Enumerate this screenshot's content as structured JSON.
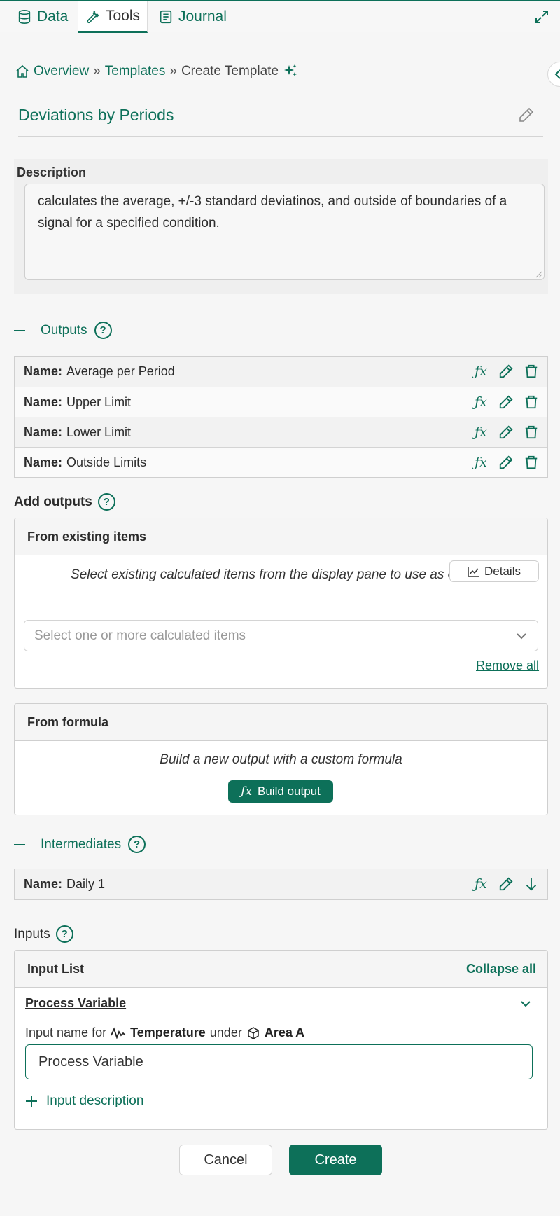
{
  "tabs": [
    {
      "label": "Data",
      "icon": "database-icon"
    },
    {
      "label": "Tools",
      "icon": "wrench-icon"
    },
    {
      "label": "Journal",
      "icon": "journal-icon"
    }
  ],
  "breadcrumb": {
    "items": [
      "Overview",
      "Templates",
      "Create Template"
    ],
    "separator": "»"
  },
  "template": {
    "title": "Deviations by Periods",
    "description_label": "Description",
    "description": "calculates the average, +/-3 standard deviatinos, and outside of boundaries of a signal for a specified condition."
  },
  "outputs": {
    "heading": "Outputs",
    "name_label": "Name:",
    "items": [
      "Average per Period",
      "Upper Limit",
      "Lower Limit",
      "Outside Limits"
    ]
  },
  "add_outputs": {
    "heading": "Add outputs",
    "existing": {
      "title": "From existing items",
      "text": "Select existing calculated items from the display pane to use as outputs",
      "details_label": "Details",
      "select_placeholder": "Select one or more calculated items",
      "remove_all": "Remove all"
    },
    "formula": {
      "title": "From formula",
      "text": "Build a new output with a custom formula",
      "button": "Build output"
    }
  },
  "intermediates": {
    "heading": "Intermediates",
    "name_label": "Name:",
    "items": [
      "Daily 1"
    ]
  },
  "inputs": {
    "heading": "Inputs",
    "list_title": "Input List",
    "collapse_all": "Collapse all",
    "item": {
      "title": "Process Variable",
      "prefix": "Input name for",
      "signal": "Temperature",
      "under": "under",
      "asset": "Area A",
      "value": "Process Variable",
      "add_description": "Input description"
    }
  },
  "actions": {
    "cancel": "Cancel",
    "create": "Create"
  },
  "colors": {
    "accent": "#0d7059",
    "background": "#f6f6f6"
  }
}
